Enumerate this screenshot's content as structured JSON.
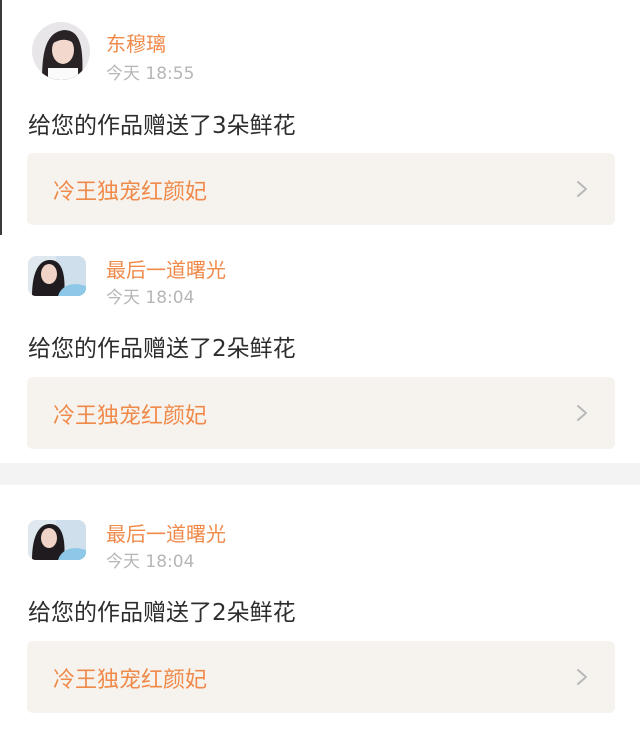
{
  "notifications": [
    {
      "username": "东穆璃",
      "timestamp": "今天 18:55",
      "message": "给您的作品赠送了3朵鲜花",
      "work_title": "冷王独宠红颜妃",
      "avatar": "user-avatar"
    },
    {
      "username": "最后一道曙光",
      "timestamp": "今天 18:04",
      "message": "给您的作品赠送了2朵鲜花",
      "work_title": "冷王独宠红颜妃",
      "avatar": "user-avatar"
    },
    {
      "username": "最后一道曙光",
      "timestamp": "今天 18:04",
      "message": "给您的作品赠送了2朵鲜花",
      "work_title": "冷王独宠红颜妃",
      "avatar": "user-avatar"
    }
  ],
  "icons": {
    "card_arrow": "chevron-right-icon"
  },
  "colors": {
    "accent": "#f08a4b",
    "card_background": "#f6f3ee",
    "timestamp": "#b6b6b6",
    "message_text": "#2d2d2d",
    "section_divider": "#f3f3f3"
  }
}
